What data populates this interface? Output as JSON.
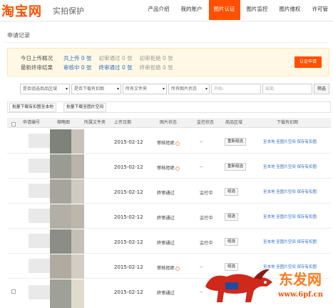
{
  "header": {
    "logo": "淘宝网",
    "subtitle": "实拍保护",
    "nav": [
      "产品介绍",
      "我的账户",
      "图片认证",
      "图片监控",
      "图片维权",
      "许可管"
    ]
  },
  "section_title": "申请记录",
  "summary": {
    "row1_label": "今日上传概况",
    "row1_items": [
      {
        "label": "共上传",
        "value": "0 张"
      },
      {
        "label": "初审通过",
        "value": "0 张"
      },
      {
        "label": "初审拒绝",
        "value": "0 张"
      }
    ],
    "row2_label": "最新终审结果",
    "row2_items": [
      {
        "label": "审核中",
        "value": "0 张"
      },
      {
        "label": "终审通过",
        "value": "0 张"
      },
      {
        "label": "终审拒绝",
        "value": "0 张"
      }
    ],
    "auth_button": "认证申请"
  },
  "filters": {
    "region": "是否组选商品区域",
    "download": "是否下载有扣图",
    "folder": "所有文件夹",
    "status": "所有图片状态",
    "start_placeholder": "开始:",
    "end_placeholder": "结束:",
    "filter_button": "筛选"
  },
  "batch": {
    "download_local": "批量下载有扣图至本地",
    "download_space": "批量下载至图片空间"
  },
  "table": {
    "headers": [
      "申请编号",
      "缩略图",
      "所属文件夹",
      "上传日期",
      "图片状态",
      "监控状态",
      "商品区域",
      "下载有扣图"
    ],
    "rows": [
      {
        "date": "2015-02-12",
        "status": "审核拒绝",
        "monitor": "--",
        "region": "重新组选",
        "links": "至本地 至图片空间 保存有扣图"
      },
      {
        "date": "2015-02-12",
        "status": "审核拒绝",
        "monitor": "--",
        "region": "重新组选",
        "links": "至本地 至图片空间 保存有扣图"
      },
      {
        "date": "2015-02-12",
        "status": "终审通过",
        "monitor": "监控中",
        "region": "组选",
        "links": "至本地 至图片空间 保存有扣图"
      },
      {
        "date": "2015-02-12",
        "status": "终审通过",
        "monitor": "监控中",
        "region": "组选",
        "links": "至本地 至图片空间 保存有扣图"
      },
      {
        "date": "2015-02-12",
        "status": "终审通过",
        "monitor": "监控中",
        "region": "组选",
        "links": "至本地 至图片空间 保存有扣图"
      },
      {
        "date": "2015-02-12",
        "status": "审核拒绝",
        "monitor": "--",
        "region": "组选",
        "links": "至本地 至图片空间 保存有扣图"
      },
      {
        "date": "2015-02-12",
        "status": "终审通过",
        "monitor": "--",
        "region": "组选",
        "links": "至本地 至图片空间"
      }
    ]
  },
  "watermark": {
    "text": "东发网",
    "url": "www.6pf.cn"
  },
  "colors": {
    "brand": "#ff5000",
    "link": "#2a6fc9",
    "summary_bg": "#fff8e4"
  }
}
